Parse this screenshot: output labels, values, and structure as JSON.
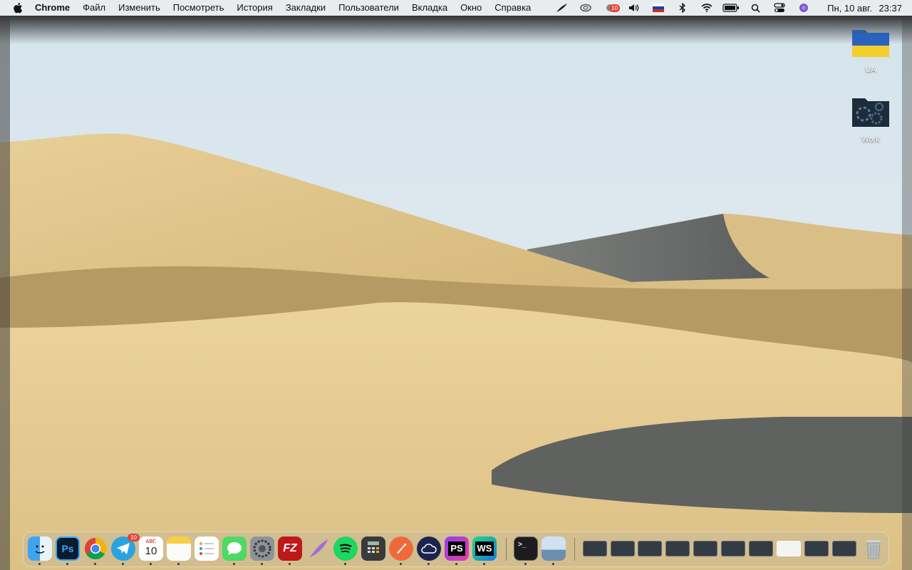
{
  "menubar": {
    "app_name": "Chrome",
    "items": [
      "Файл",
      "Изменить",
      "Посмотреть",
      "История",
      "Закладки",
      "Пользователи",
      "Вкладка",
      "Окно",
      "Справка"
    ],
    "status_icons": [
      "quill-icon",
      "creative-cloud-icon",
      "notification-icon",
      "volume-icon",
      "russian-flag-input-icon",
      "bluetooth-icon",
      "wifi-icon",
      "battery-icon",
      "search-icon",
      "control-center-icon",
      "siri-icon"
    ],
    "notification_badge": "10",
    "clock": {
      "date": "Пн, 10 авг.",
      "time": "23:37"
    }
  },
  "desktop": {
    "icons": [
      {
        "label": "UA",
        "icon": "ukraine-flag-folder-icon"
      },
      {
        "label": "Work",
        "icon": "gear-folder-icon"
      }
    ]
  },
  "dock": {
    "apps": [
      {
        "name": "finder-icon",
        "label": ""
      },
      {
        "name": "photoshop-icon",
        "label": "Ps"
      },
      {
        "name": "chrome-icon",
        "label": ""
      },
      {
        "name": "telegram-icon",
        "label": "",
        "badge": "10"
      },
      {
        "name": "calendar-icon",
        "label": "10",
        "month": "АВГ."
      },
      {
        "name": "notes-icon",
        "label": ""
      },
      {
        "name": "reminders-icon",
        "label": ""
      },
      {
        "name": "messages-icon",
        "label": ""
      },
      {
        "name": "system-preferences-icon",
        "label": ""
      },
      {
        "name": "filezilla-icon",
        "label": "FZ"
      },
      {
        "name": "quill-app-icon",
        "label": ""
      },
      {
        "name": "spotify-icon",
        "label": ""
      },
      {
        "name": "calculator-icon",
        "label": ""
      },
      {
        "name": "paw-icon",
        "label": ""
      },
      {
        "name": "cloud-app-icon",
        "label": ""
      },
      {
        "name": "phpstorm-icon",
        "label": "PS"
      },
      {
        "name": "webstorm-icon",
        "label": "WS"
      },
      {
        "name": "terminal-icon",
        "label": ">_"
      },
      {
        "name": "preview-icon",
        "label": ""
      }
    ],
    "minimized_windows_count": 11,
    "trash": "trash-icon"
  }
}
